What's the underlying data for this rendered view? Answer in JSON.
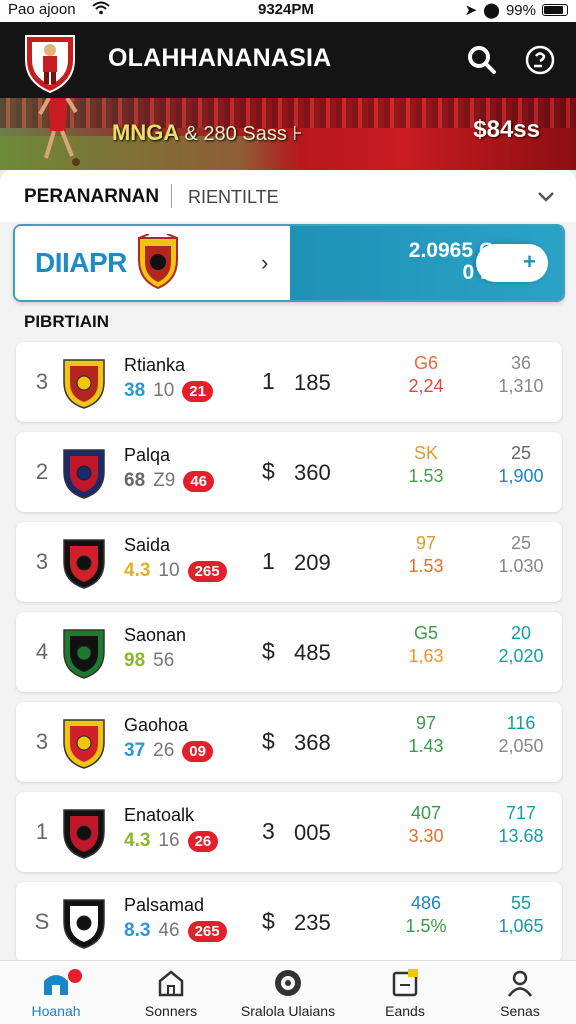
{
  "status_bar": {
    "carrier": "Pao ajoon",
    "time": "9324PM",
    "battery": "99%"
  },
  "header": {
    "title": "OLAHHANANASIA"
  },
  "banner": {
    "text_main": "MNGA",
    "text_sub": "& 280 Sass ⊦",
    "price": "$84ss"
  },
  "tabs": {
    "primary": "PERANARNAN",
    "secondary": "RIENTILTE"
  },
  "promo": {
    "name": "DIIAPR",
    "value_line1": "2.0965 C",
    "value_line2": "0 E",
    "add_label": "+"
  },
  "section_title": "PIBRTIAIN",
  "teams": [
    {
      "rank": "3",
      "name": "Rtianka",
      "stat_a": "38",
      "stat_b": "10",
      "badge": "21",
      "symbol": "1",
      "amount": "185",
      "c1_top": "G6",
      "c1_bottom": "2,24",
      "c2_top": "36",
      "c2_bottom": "1,310",
      "c1_top_color": "#e46a3a",
      "c1_bottom_color": "#e04a3a",
      "c2_top_color": "#888888",
      "c2_bottom_color": "#888888",
      "stat_a_color": "#2a97d8",
      "logo_colors": [
        "#f1c40f",
        "#b3261e"
      ]
    },
    {
      "rank": "2",
      "name": "Palqa",
      "stat_a": "68",
      "stat_b": "Z9",
      "badge": "46",
      "symbol": "$",
      "amount": "360",
      "c1_top": "SK",
      "c1_bottom": "1.53",
      "c2_top": "25",
      "c2_bottom": "1,900",
      "c1_top_color": "#e39a2a",
      "c1_bottom_color": "#4aa04a",
      "c2_top_color": "#666666",
      "c2_bottom_color": "#1a86c8",
      "stat_a_color": "#666666",
      "logo_colors": [
        "#1b2a6b",
        "#c0172a"
      ]
    },
    {
      "rank": "3",
      "name": "Saida",
      "stat_a": "4.3",
      "stat_b": "10",
      "badge": "265",
      "symbol": "1",
      "amount": "209",
      "c1_top": "97",
      "c1_bottom": "1.53",
      "c2_top": "25",
      "c2_bottom": "1.030",
      "c1_top_color": "#e39a2a",
      "c1_bottom_color": "#e4702a",
      "c2_top_color": "#888888",
      "c2_bottom_color": "#888888",
      "stat_a_color": "#e0b020",
      "logo_colors": [
        "#111111",
        "#d0202a"
      ]
    },
    {
      "rank": "4",
      "name": "Saonan",
      "stat_a": "98",
      "stat_b": "56",
      "badge": "",
      "symbol": "$",
      "amount": "485",
      "c1_top": "G5",
      "c1_bottom": "1,63",
      "c2_top": "20",
      "c2_bottom": "2,020",
      "c1_top_color": "#3a9a4a",
      "c1_bottom_color": "#e39a2a",
      "c2_top_color": "#1a9aa8",
      "c2_bottom_color": "#1a9aa8",
      "stat_a_color": "#8ab82a",
      "logo_colors": [
        "#1e7a2e",
        "#111111"
      ]
    },
    {
      "rank": "3",
      "name": "Gaohoa",
      "stat_a": "37",
      "stat_b": "26",
      "badge": "09",
      "symbol": "$",
      "amount": "368",
      "c1_top": "97",
      "c1_bottom": "1.43",
      "c2_top": "116",
      "c2_bottom": "2,050",
      "c1_top_color": "#3a9a4a",
      "c1_bottom_color": "#3a9a4a",
      "c2_top_color": "#1a9aa8",
      "c2_bottom_color": "#888888",
      "stat_a_color": "#2a97d8",
      "logo_colors": [
        "#f1c40f",
        "#d0202a"
      ]
    },
    {
      "rank": "1",
      "name": "Enatoalk",
      "stat_a": "4.3",
      "stat_b": "16",
      "badge": "26",
      "symbol": "3",
      "amount": "005",
      "c1_top": "407",
      "c1_bottom": "3.30",
      "c2_top": "717",
      "c2_bottom": "13.68",
      "c1_top_color": "#3a9a4a",
      "c1_bottom_color": "#e4702a",
      "c2_top_color": "#1a9aa8",
      "c2_bottom_color": "#1a9aa8",
      "stat_a_color": "#8ab82a",
      "logo_colors": [
        "#111111",
        "#c0172a"
      ]
    },
    {
      "rank": "S",
      "name": "Palsamad",
      "stat_a": "8.3",
      "stat_b": "46",
      "badge": "265",
      "symbol": "$",
      "amount": "235",
      "c1_top": "486",
      "c1_bottom": "1.5%",
      "c2_top": "55",
      "c2_bottom": "1,065",
      "c1_top_color": "#1a86c8",
      "c1_bottom_color": "#3a9a4a",
      "c2_top_color": "#1a9aa8",
      "c2_bottom_color": "#1a9aa8",
      "stat_a_color": "#2a97d8",
      "logo_colors": [
        "#111111",
        "#ffffff"
      ]
    }
  ],
  "bottom_nav": [
    {
      "label": "Hoanah",
      "icon": "home-icon",
      "active": true
    },
    {
      "label": "Sonners",
      "icon": "house-icon",
      "active": false
    },
    {
      "label": "Sralola Ulaians",
      "icon": "target-icon",
      "active": false
    },
    {
      "label": "Eands",
      "icon": "wallet-icon",
      "active": false
    },
    {
      "label": "Senas",
      "icon": "user-icon",
      "active": false
    }
  ],
  "colors": {
    "header_bg": "#141414",
    "accent_red": "#c81c20",
    "accent_teal": "#1f91b7",
    "active_nav": "#1a86c8"
  }
}
